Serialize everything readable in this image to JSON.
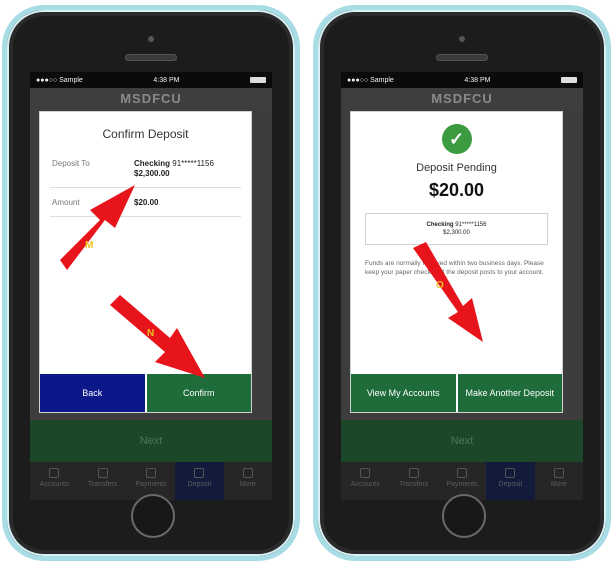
{
  "status": {
    "carrier": "●●●○○ Sample",
    "time": "4:38 PM"
  },
  "app_header": "MSDFCU",
  "next_label": "Next",
  "tabs": [
    "Accounts",
    "Transfers",
    "Payments",
    "Deposit",
    "More"
  ],
  "confirm_modal": {
    "title": "Confirm Deposit",
    "deposit_to_label": "Deposit To",
    "account_name": "Checking",
    "account_mask": " 91*****1156",
    "account_balance": "$2,300.00",
    "amount_label": "Amount",
    "amount_value": "$20.00",
    "back_label": "Back",
    "confirm_label": "Confirm"
  },
  "pending_modal": {
    "title": "Deposit Pending",
    "amount": "$20.00",
    "account_name": "Checking",
    "account_mask": " 91*****1156",
    "account_balance": "$2,300.00",
    "note": "Funds are normally received within two business days. Please keep your paper check until the deposit posts to your account.",
    "view_accounts_label": "View My Accounts",
    "make_another_label": "Make Another Deposit"
  },
  "annotations": {
    "arrow_m": "M",
    "arrow_n": "N",
    "arrow_o": "O"
  },
  "colors": {
    "back_button": "#0c1789",
    "green_button": "#1e6c3a",
    "arrow": "#e8141c",
    "phone_frame": "#a9dde6"
  }
}
